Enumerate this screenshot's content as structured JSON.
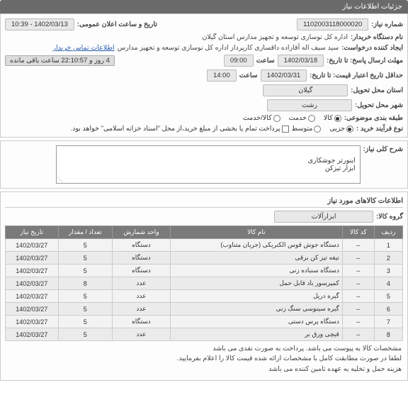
{
  "header": {
    "title": "جزئیات اطلاعات نیاز"
  },
  "need_no": {
    "label": "شماره نیاز:",
    "value": "1102003118000020"
  },
  "announce": {
    "label": "تاریخ و ساعت اعلان عمومی:",
    "value": "1402/03/13 - 10:39"
  },
  "buyer": {
    "label": "نام دستگاه خریدار:",
    "value": "اداره کل نوسازی  توسعه و تجهیز مدارس استان گیلان"
  },
  "creator": {
    "label": "ایجاد کننده درخواست:",
    "value": "سید سیف اله آقازاده داقسازی کارپرداز اداره کل نوسازی  توسعه و تجهیز مدارس",
    "contact": "اطلاعات تماس خریدار"
  },
  "reply_deadline": {
    "label": "مهلت ارسال پاسخ: تا تاریخ:",
    "date": "1402/03/18",
    "time_label": "ساعت",
    "time": "09:00",
    "remain": "4 روز و 22:10:57 ساعت باقی مانده"
  },
  "price_validity": {
    "label": "حداقل تاریخ اعتبار قیمت: تا تاریخ:",
    "date": "1402/03/31",
    "time_label": "ساعت",
    "time": "14:00"
  },
  "location_prov": {
    "label": "استان محل تحویل:",
    "value": "گیلان"
  },
  "location_city": {
    "label": "شهر محل تحویل:",
    "value": "رشت"
  },
  "classification": {
    "label": "طبقه بندی موضوعی:",
    "options": [
      "کالا",
      "خدمت",
      "کالا/خدمت"
    ],
    "selected": 0
  },
  "purchase_type": {
    "label": "نوع فرآیند خرید :",
    "options": [
      "جزیی",
      "متوسط"
    ],
    "selected": 0,
    "checkbox_label": "پرداخت تمام یا بخشی از مبلغ خرید،از محل \"اسناد خزانه اسلامی\" خواهد بود."
  },
  "desc": {
    "label": "شرح کلی نیاز:",
    "value": "اینورتر جوشکاری\nابزار تیزکن"
  },
  "items_section": {
    "title": "اطلاعات کالاهای مورد نیاز"
  },
  "goods_group": {
    "label": "گروه کالا:",
    "value": "ابزارآلات"
  },
  "table": {
    "headers": [
      "ردیف",
      "کد کالا",
      "نام کالا",
      "واحد شمارش",
      "تعداد / مقدار",
      "تاریخ نیاز"
    ],
    "rows": [
      {
        "idx": "1",
        "code": "--",
        "name": "دستگاه جوش قوس الکتریکی (جریان متناوب)",
        "unit": "دستگاه",
        "qty": "5",
        "date": "1402/03/27"
      },
      {
        "idx": "2",
        "code": "--",
        "name": "تیغه تیز کن برقی",
        "unit": "دستگاه",
        "qty": "5",
        "date": "1402/03/27"
      },
      {
        "idx": "3",
        "code": "--",
        "name": "دستگاه سنباده زنی",
        "unit": "دستگاه",
        "qty": "5",
        "date": "1402/03/27"
      },
      {
        "idx": "4",
        "code": "--",
        "name": "کمپرسور باد قابل حمل",
        "unit": "عدد",
        "qty": "8",
        "date": "1402/03/27"
      },
      {
        "idx": "5",
        "code": "--",
        "name": "گیره دریل",
        "unit": "عدد",
        "qty": "5",
        "date": "1402/03/27"
      },
      {
        "idx": "6",
        "code": "--",
        "name": "گیره سینوسی سنگ زنی",
        "unit": "عدد",
        "qty": "5",
        "date": "1402/03/27"
      },
      {
        "idx": "7",
        "code": "--",
        "name": "دستگاه پرس دستی",
        "unit": "دستگاه",
        "qty": "5",
        "date": "1402/03/27"
      },
      {
        "idx": "8",
        "code": "--",
        "name": "قیچی ورق بر",
        "unit": "عدد",
        "qty": "5",
        "date": "1402/03/27"
      }
    ]
  },
  "notes": {
    "line1": "مشخصات کالا به پیوست می باشد. پرداخت به صورت نقدی می باشد",
    "line2": "لطفا در صورت مطابقت کامل با مشخصات ارائه شده قیمت کالا را اعلام بفرمایید.",
    "line3": "هزینه حمل و تخلیه به عهده تامین کننده می باشد"
  }
}
